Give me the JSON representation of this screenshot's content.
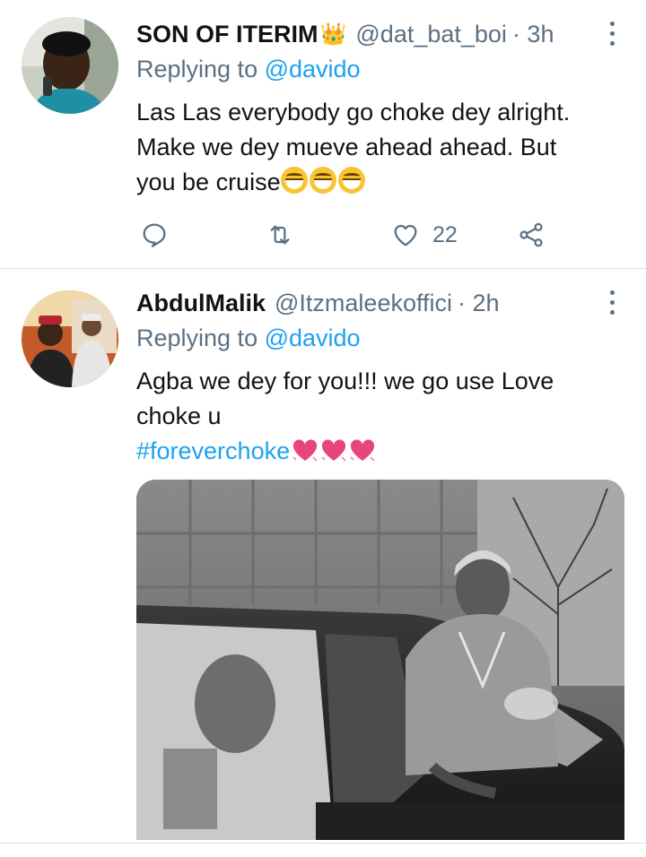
{
  "tweets": [
    {
      "display_name": "SON OF ITERIM",
      "badge_emoji": "👑",
      "handle": "@dat_bat_boi",
      "time": "· 3h",
      "replying_label": "Replying to ",
      "replying_mention": "@davido",
      "text_line_1": "Las Las everybody go choke dey alright.",
      "text_line_2": "Make we dey mueve ahead ahead. But",
      "text_line_3": "you be cruise",
      "reply_icon": "reply-icon",
      "retweet_icon": "retweet-icon",
      "like_icon": "heart-icon",
      "like_count": "22",
      "share_icon": "share-icon"
    },
    {
      "display_name": "AbdulMalik",
      "handle": "@Itzmaleekoffici",
      "time": "· 2h",
      "replying_label": "Replying to ",
      "replying_mention": "@davido",
      "text_line_1": "Agba we dey for you!!! we go use Love",
      "text_line_2": "choke u",
      "hashtag": "#foreverchoke"
    }
  ],
  "colors": {
    "accent": "#1da1f2",
    "secondary_text": "#5b7083",
    "primary_text": "#0f1419",
    "divider": "#d9dee2",
    "heart_emoji": "#e8457a"
  }
}
